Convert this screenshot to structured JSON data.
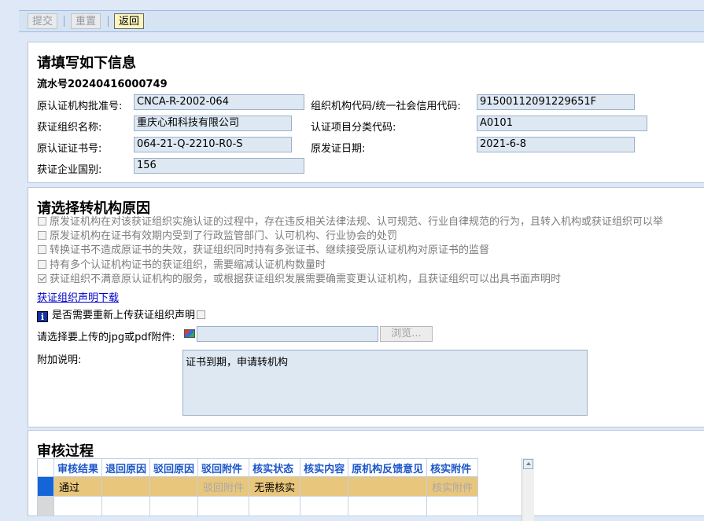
{
  "toolbar": {
    "submit": "提交",
    "reset": "重置",
    "back": "返回"
  },
  "info": {
    "title": "请填写如下信息",
    "serial": "流水号20240416000749",
    "fields": {
      "orig_approval_label": "原认证机构批准号:",
      "orig_approval_value": "CNCA-R-2002-064",
      "org_code_label": "组织机构代码/统一社会信用代码:",
      "org_code_value": "91500112091229651F",
      "org_name_label": "获证组织名称:",
      "org_name_value": "重庆心和科技有限公司",
      "category_label": "认证项目分类代码:",
      "category_value": "A0101",
      "cert_no_label": "原认证证书号:",
      "cert_no_value": "064-21-Q-2210-R0-S",
      "issue_date_label": "原发证日期:",
      "issue_date_value": "2021-6-8",
      "country_label": "获证企业国别:",
      "country_value": "156"
    }
  },
  "reason": {
    "title": "请选择转机构原因",
    "options": [
      {
        "label": "原发证机构在对该获证组织实施认证的过程中，存在违反相关法律法规、认可规范、行业自律规范的行为，且转入机构或获证组织可以举",
        "checked": false
      },
      {
        "label": "原发证机构在证书有效期内受到了行政监管部门、认可机构、行业协会的处罚",
        "checked": false
      },
      {
        "label": "转换证书不造成原证书的失效，获证组织同时持有多张证书、继续接受原认证机构对原证书的监督",
        "checked": false
      },
      {
        "label": "持有多个认证机构证书的获证组织，需要缩减认证机构数量时",
        "checked": false
      },
      {
        "label": "获证组织不满意原认证机构的服务，或根据获证组织发展需要确需变更认证机构，且获证组织可以出具书面声明时",
        "checked": true
      }
    ],
    "download_link": "获证组织声明下载",
    "reupload_label": "是否需要重新上传获证组织声明",
    "upload_label": "请选择要上传的jpg或pdf附件:",
    "browse": "浏览...",
    "note_label": "附加说明:",
    "note_value": "证书到期，申请转机构"
  },
  "review": {
    "title": "审核过程",
    "columns": [
      "审核结果",
      "退回原因",
      "驳回原因",
      "驳回附件",
      "核实状态",
      "核实内容",
      "原机构反馈意见",
      "核实附件"
    ],
    "rows": [
      {
        "审核结果": "通过",
        "退回原因": "",
        "驳回原因": "",
        "驳回附件": "驳回附件",
        "核实状态": "无需核实",
        "核实内容": "",
        "原机构反馈意见": "",
        "核实附件": "核实附件"
      }
    ]
  }
}
